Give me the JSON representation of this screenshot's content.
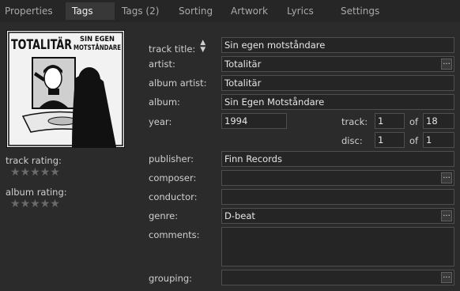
{
  "tabs": [
    "Properties",
    "Tags",
    "Tags (2)",
    "Sorting",
    "Artwork",
    "Lyrics",
    "Settings"
  ],
  "active_tab": "Tags",
  "artwork": {
    "band_text": "TOTALITÄR",
    "title_line1": "SIN EGEN",
    "title_line2": "MOTSTÅNDARE"
  },
  "ratings": {
    "track_label": "track rating:",
    "album_label": "album rating:",
    "track_stars": 0,
    "album_stars": 0,
    "max_stars": 5
  },
  "labels": {
    "track_title": "track title:",
    "artist": "artist:",
    "album_artist": "album artist:",
    "album": "album:",
    "year": "year:",
    "track": "track:",
    "disc": "disc:",
    "of": "of",
    "publisher": "publisher:",
    "composer": "composer:",
    "conductor": "conductor:",
    "genre": "genre:",
    "comments": "comments:",
    "grouping": "grouping:"
  },
  "values": {
    "track_title": "Sin egen motståndare",
    "artist": "Totalitär",
    "album_artist": "Totalitär",
    "album": "Sin Egen Motståndare",
    "year": "1994",
    "track_number": "1",
    "track_total": "18",
    "disc_number": "1",
    "disc_total": "1",
    "publisher": "Finn Records",
    "composer": "",
    "conductor": "",
    "genre": "D-beat",
    "comments": "",
    "grouping": ""
  },
  "ellipsis": "...",
  "sort_icon": "sort-updown-icon"
}
